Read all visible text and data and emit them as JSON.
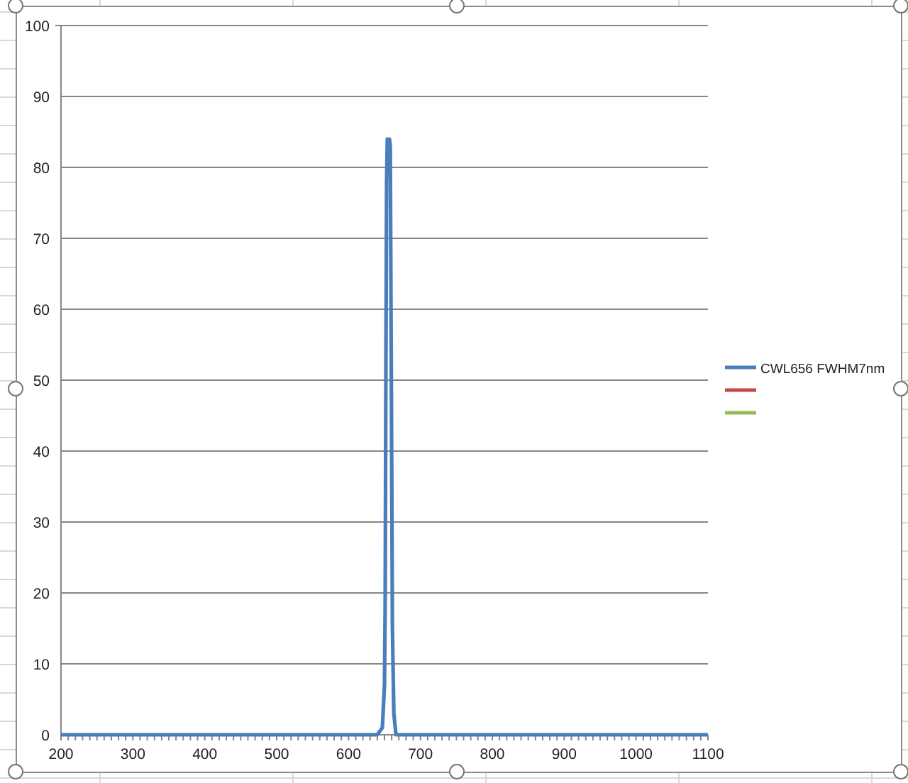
{
  "chart": {
    "chart_data": {
      "type": "line",
      "x": [
        200,
        640,
        647,
        650,
        651,
        652,
        653,
        654,
        655,
        656,
        657,
        658,
        659,
        660,
        661,
        663,
        666,
        1100
      ],
      "series": [
        {
          "name": "CWL656 FWHM7nm",
          "color": "#4a7ebb",
          "values": [
            0,
            0,
            1,
            7,
            19,
            52,
            78,
            84,
            83,
            80,
            84,
            83,
            60,
            38,
            15,
            3,
            0,
            0
          ]
        },
        {
          "color": "#be4b48",
          "values": [
            null,
            null,
            null,
            null,
            null,
            null,
            null,
            null,
            null,
            null,
            null,
            null,
            null,
            null,
            null,
            null,
            null,
            null
          ]
        },
        {
          "color": "#98b954",
          "values": [
            null,
            null,
            null,
            null,
            null,
            null,
            null,
            null,
            null,
            null,
            null,
            null,
            null,
            null,
            null,
            null,
            null,
            null
          ]
        }
      ],
      "grid": true,
      "xlim": [
        200,
        1100
      ],
      "ylim": [
        0,
        100
      ],
      "xticks": [
        200,
        300,
        400,
        500,
        600,
        700,
        800,
        900,
        1000,
        1100
      ],
      "yticks": [
        0,
        10,
        20,
        30,
        40,
        50,
        60,
        70,
        80,
        90,
        100
      ]
    }
  }
}
